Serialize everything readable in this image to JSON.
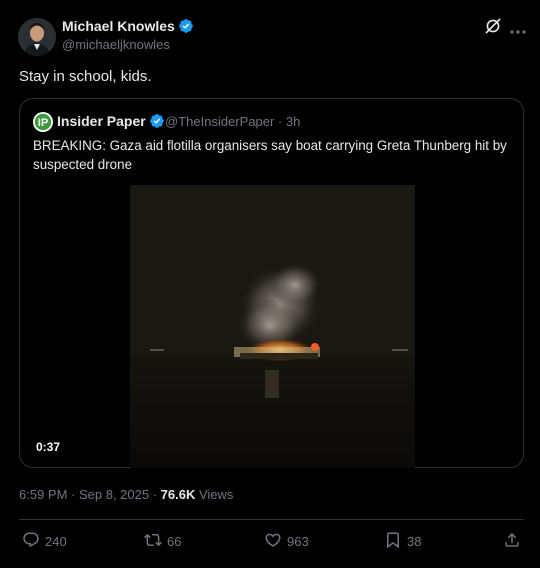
{
  "post": {
    "author_name": "Michael Knowles",
    "author_handle": "@michaeljknowles",
    "text": "Stay in school, kids.",
    "timestamp": "6:59 PM · Sep 8, 2025 · ",
    "views_count": "76.6K",
    "views_label": " Views"
  },
  "quote": {
    "author_name": "Insider Paper",
    "author_handle": "@TheInsiderPaper",
    "time_ago": "3h",
    "text": "BREAKING: Gaza aid flotilla organisers say boat carrying Greta Thunberg hit by suspected drone",
    "video_duration": "0:37"
  },
  "actions": {
    "replies": "240",
    "reposts": "66",
    "likes": "963",
    "bookmarks": "38"
  },
  "colors": {
    "background": "#000000",
    "text": "#e7e9ea",
    "muted": "#71767b",
    "verified": "#1d9bf0",
    "border": "#2f3336"
  },
  "icons": [
    "verified-badge-icon",
    "grok-icon",
    "more-icon",
    "reply-icon",
    "repost-icon",
    "like-icon",
    "bookmark-icon",
    "share-icon"
  ]
}
